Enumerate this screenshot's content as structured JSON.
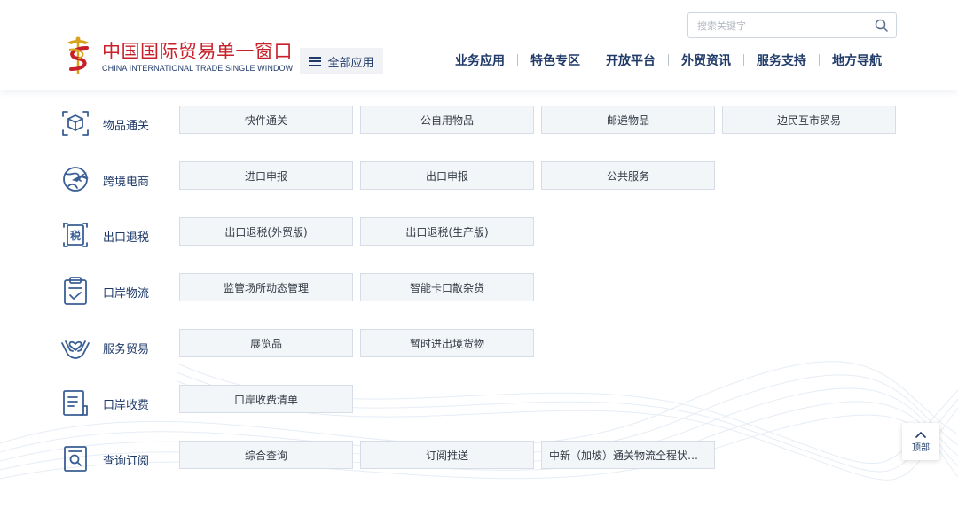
{
  "brand": {
    "name_cn": "中国国际贸易单一窗口",
    "name_en": "CHINA INTERNATIONAL TRADE SINGLE WINDOW",
    "logo_icon": "caduceus-logo-icon",
    "brand_color": "#c8202a"
  },
  "header": {
    "all_apps_label": "全部应用",
    "search": {
      "placeholder": "搜索关键字",
      "value": ""
    },
    "nav": [
      "业务应用",
      "特色专区",
      "开放平台",
      "外贸资讯",
      "服务支持",
      "地方导航"
    ]
  },
  "categories": [
    {
      "label": "物品通关",
      "icon": "package-scan-icon",
      "items": [
        "快件通关",
        "公自用物品",
        "邮递物品",
        "边民互市贸易"
      ]
    },
    {
      "label": "跨境电商",
      "icon": "globe-plane-icon",
      "items": [
        "进口申报",
        "出口申报",
        "公共服务"
      ]
    },
    {
      "label": "出口退税",
      "icon": "tax-document-icon",
      "items": [
        "出口退税(外贸版)",
        "出口退税(生产版)"
      ]
    },
    {
      "label": "口岸物流",
      "icon": "clipboard-check-icon",
      "items": [
        "监管场所动态管理",
        "智能卡口散杂货"
      ]
    },
    {
      "label": "服务贸易",
      "icon": "hand-heart-icon",
      "items": [
        "展览品",
        "暂时进出境货物"
      ]
    },
    {
      "label": "口岸收费",
      "icon": "fee-list-icon",
      "items": [
        "口岸收费清单"
      ]
    },
    {
      "label": "查询订阅",
      "icon": "search-document-icon",
      "items": [
        "综合查询",
        "订阅推送",
        "中新（加坡）通关物流全程状态查询"
      ]
    }
  ],
  "back_to_top_label": "顶部",
  "colors": {
    "text_primary": "#1f3a68",
    "button_bg": "#f3f6f9",
    "button_border": "#d6dde6"
  }
}
